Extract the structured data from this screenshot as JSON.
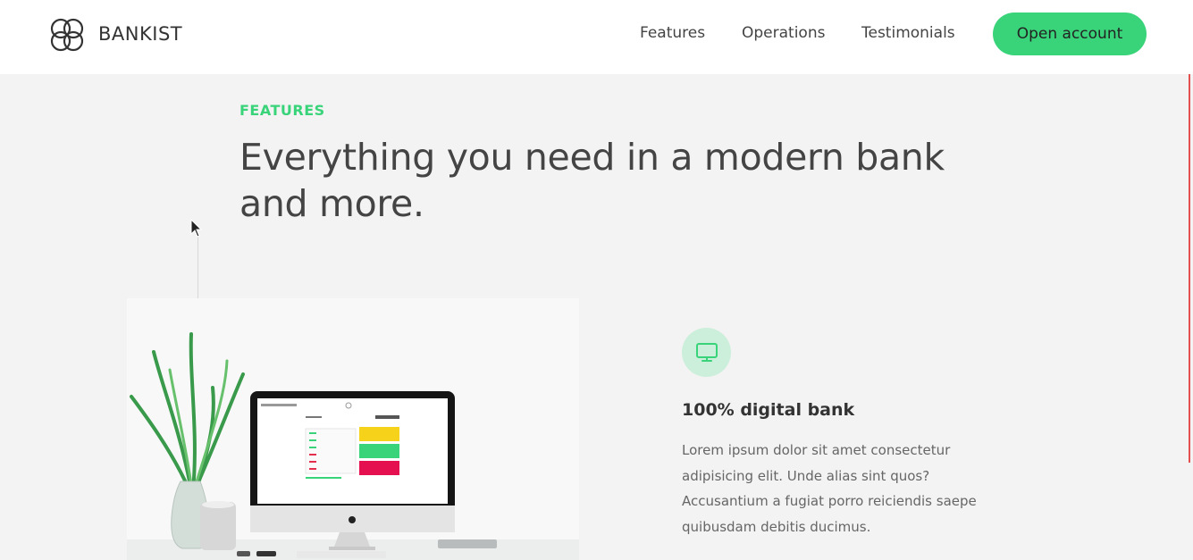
{
  "nav": {
    "logo_text": "BANKIST",
    "links": [
      "Features",
      "Operations",
      "Testimonials"
    ],
    "cta_label": "Open account"
  },
  "features_section": {
    "label": "FEATURES",
    "title": "Everything you need in a modern bank and more.",
    "feature": {
      "icon": "monitor-icon",
      "heading": "100% digital bank",
      "text": "Lorem ipsum dolor sit amet consectetur adipisicing elit. Unde alias sint quos? Accusantium a fugiat porro reiciendis saepe quibusdam debitis ducimus."
    }
  },
  "colors": {
    "accent": "#39d37a",
    "accent_light": "#ccefdb",
    "heading": "#444444",
    "background": "#f3f3f3"
  }
}
